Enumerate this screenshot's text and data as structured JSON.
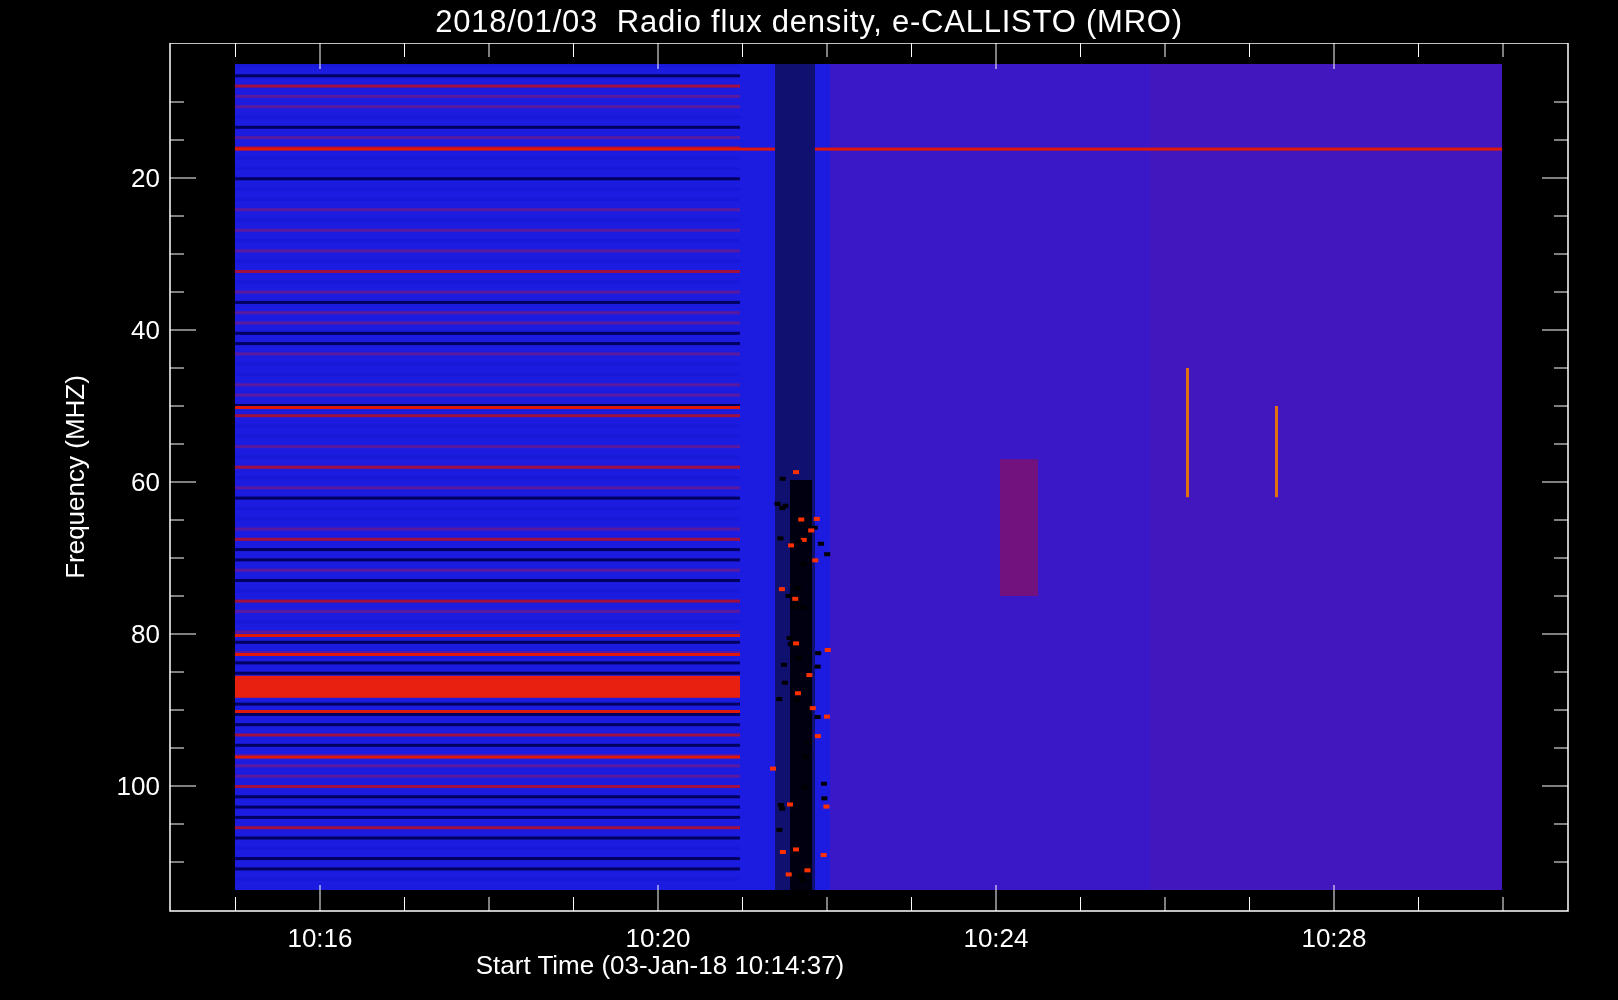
{
  "title": "2018/01/03  Radio flux density, e-CALLISTO (MRO)",
  "y_axis": {
    "label": "Frequency (MHZ)",
    "tick_labels": [
      "20",
      "40",
      "60",
      "80",
      "100"
    ]
  },
  "x_axis": {
    "label": "Start Time (03-Jan-18 10:14:37)",
    "tick_labels": [
      "10:16",
      "10:20",
      "10:24",
      "10:28"
    ]
  }
}
